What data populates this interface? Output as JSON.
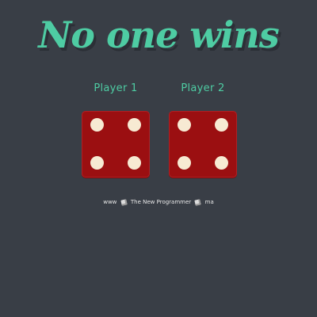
{
  "headline": "No one wins",
  "players": [
    {
      "label": "Player 1",
      "die_value": 4
    },
    {
      "label": "Player 2",
      "die_value": 4
    }
  ],
  "footer": {
    "prefix": "www",
    "middle": "The New Programmer",
    "suffix": "ma"
  },
  "icons": {
    "footer_die_left": "dice-icon",
    "footer_die_right": "dice-icon"
  },
  "colors": {
    "background": "#393e46",
    "accent": "#4ecca3",
    "die": "#9b0f11",
    "pip": "#f7ead3"
  }
}
